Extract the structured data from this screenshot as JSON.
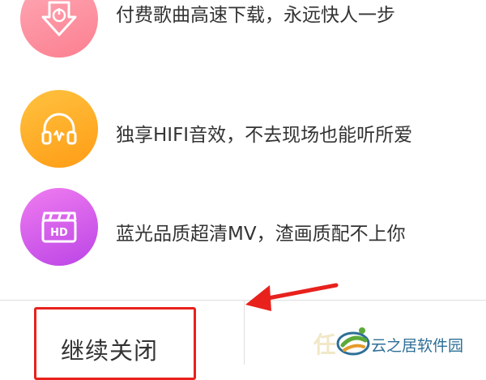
{
  "features": [
    {
      "icon": "download-icon",
      "text": "付费歌曲高速下载，永远快人一步",
      "color": "#fb7f8f"
    },
    {
      "icon": "headphones-icon",
      "text": "独享HIFI音效，不去现场也能听所爱",
      "color": "#ff9c16"
    },
    {
      "icon": "hd-video-icon",
      "text": "蓝光品质超清MV，渣画质配不上你",
      "color": "#bb45e6"
    }
  ],
  "buttons": {
    "continue_close": "继续关闭"
  },
  "watermark": {
    "text": "云之居软件园"
  },
  "colors": {
    "highlight": "#e8211c",
    "annotation_arrow": "#e8211c"
  }
}
